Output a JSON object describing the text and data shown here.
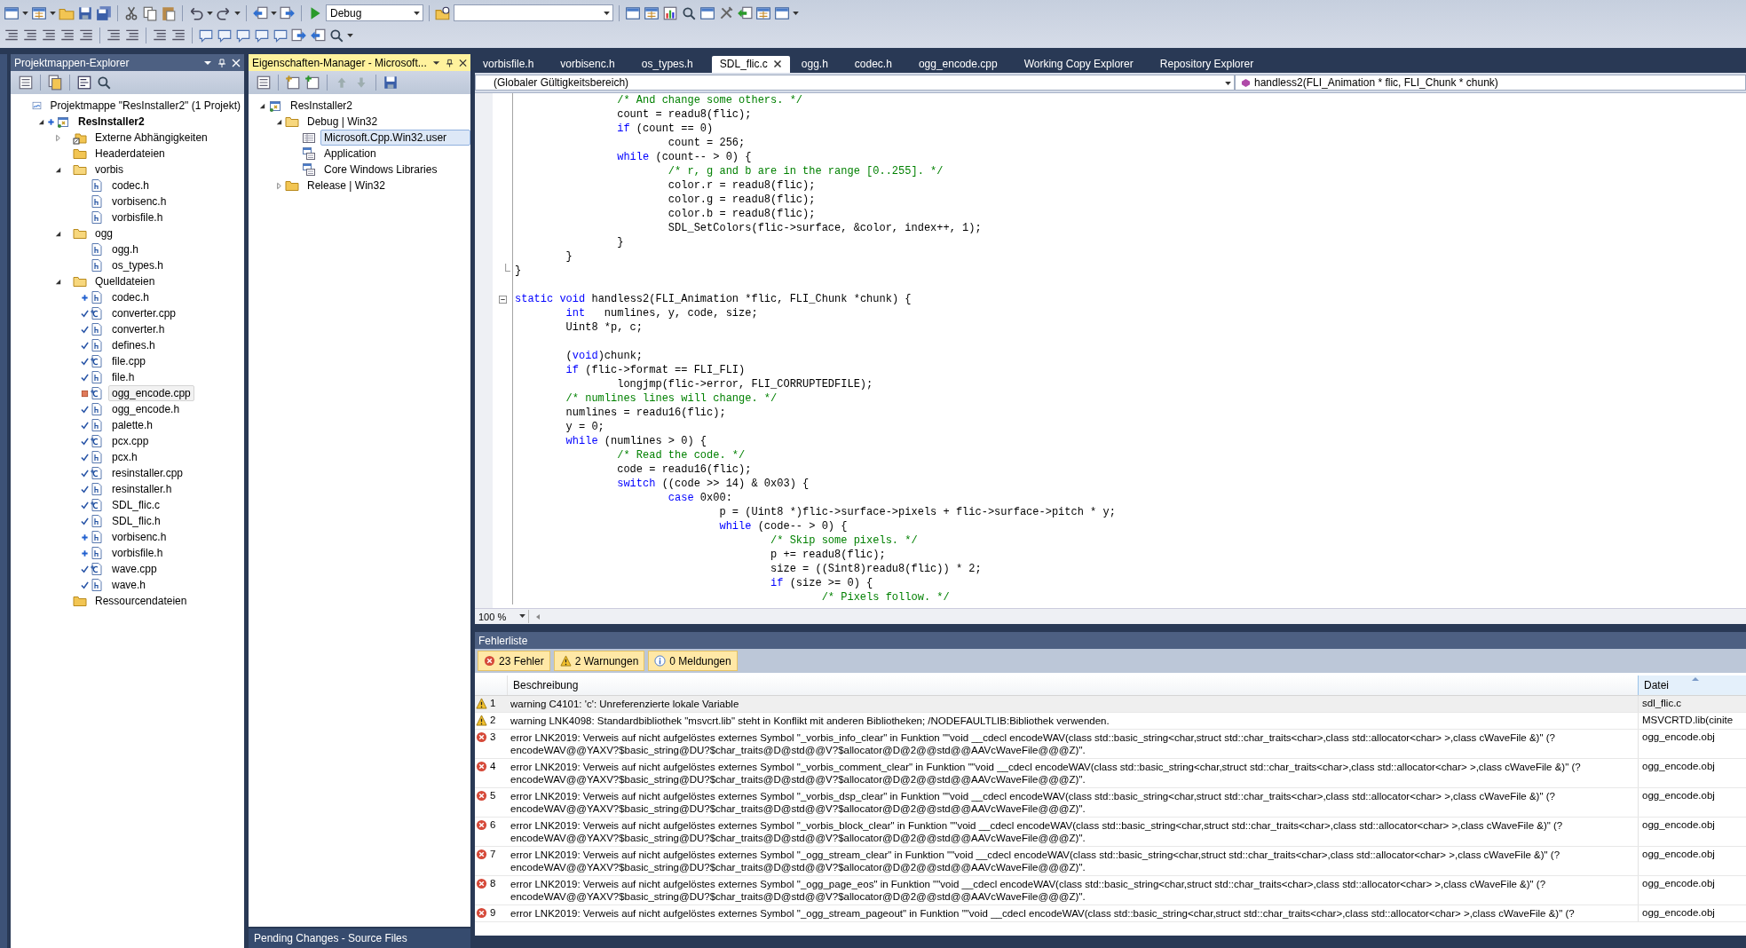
{
  "toolbar": {
    "configuration": "Debug"
  },
  "solution_explorer": {
    "title": "Projektmappen-Explorer",
    "active": false,
    "tree": [
      {
        "label": "Projektmappe \"ResInstaller2\" (1 Projekt)",
        "kind": "solution",
        "selected": false,
        "children": [
          {
            "label": "ResInstaller2",
            "kind": "project",
            "scc": {
              "kind": "added"
            },
            "startup": true,
            "expanded": true,
            "selected": false,
            "children": [
              {
                "label": "Externe Abhängigkeiten",
                "kind": "references",
                "expanded": false,
                "selected": false
              },
              {
                "label": "Headerdateien",
                "kind": "folder",
                "selected": false
              },
              {
                "label": "vorbis",
                "kind": "folder",
                "expanded": true,
                "selected": false,
                "children": [
                  {
                    "label": "codec.h",
                    "kind": "header",
                    "selected": false
                  },
                  {
                    "label": "vorbisenc.h",
                    "kind": "header",
                    "selected": false
                  },
                  {
                    "label": "vorbisfile.h",
                    "kind": "header",
                    "selected": false
                  }
                ]
              },
              {
                "label": "ogg",
                "kind": "folder",
                "expanded": true,
                "selected": false,
                "children": [
                  {
                    "label": "ogg.h",
                    "kind": "header",
                    "selected": false
                  },
                  {
                    "label": "os_types.h",
                    "kind": "header",
                    "selected": false
                  }
                ]
              },
              {
                "label": "Quelldateien",
                "kind": "folder",
                "expanded": true,
                "selected": false,
                "children": [
                  {
                    "label": "codec.h",
                    "kind": "header",
                    "scc": {
                      "kind": "added"
                    },
                    "selected": false
                  },
                  {
                    "label": "converter.cpp",
                    "kind": "source",
                    "scc": {
                      "kind": "checked-in"
                    },
                    "selected": false
                  },
                  {
                    "label": "converter.h",
                    "kind": "header",
                    "scc": {
                      "kind": "checked-in"
                    },
                    "selected": false
                  },
                  {
                    "label": "defines.h",
                    "kind": "header",
                    "scc": {
                      "kind": "checked-in"
                    },
                    "selected": false
                  },
                  {
                    "label": "file.cpp",
                    "kind": "source",
                    "scc": {
                      "kind": "checked-in"
                    },
                    "selected": false
                  },
                  {
                    "label": "file.h",
                    "kind": "header",
                    "scc": {
                      "kind": "checked-in"
                    },
                    "selected": false
                  },
                  {
                    "label": "ogg_encode.cpp",
                    "kind": "source",
                    "scc": {
                      "kind": "modified"
                    },
                    "selected": true
                  },
                  {
                    "label": "ogg_encode.h",
                    "kind": "header",
                    "scc": {
                      "kind": "checked-in"
                    },
                    "selected": false
                  },
                  {
                    "label": "palette.h",
                    "kind": "header",
                    "scc": {
                      "kind": "checked-in"
                    },
                    "selected": false
                  },
                  {
                    "label": "pcx.cpp",
                    "kind": "source",
                    "scc": {
                      "kind": "checked-in"
                    },
                    "selected": false
                  },
                  {
                    "label": "pcx.h",
                    "kind": "header",
                    "scc": {
                      "kind": "checked-in"
                    },
                    "selected": false
                  },
                  {
                    "label": "resinstaller.cpp",
                    "kind": "source",
                    "scc": {
                      "kind": "checked-in"
                    },
                    "selected": false
                  },
                  {
                    "label": "resinstaller.h",
                    "kind": "header",
                    "scc": {
                      "kind": "checked-in"
                    },
                    "selected": false
                  },
                  {
                    "label": "SDL_flic.c",
                    "kind": "source",
                    "scc": {
                      "kind": "checked-in"
                    },
                    "selected": false
                  },
                  {
                    "label": "SDL_flic.h",
                    "kind": "header",
                    "scc": {
                      "kind": "checked-in"
                    },
                    "selected": false
                  },
                  {
                    "label": "vorbisenc.h",
                    "kind": "header",
                    "scc": {
                      "kind": "added"
                    },
                    "selected": false
                  },
                  {
                    "label": "vorbisfile.h",
                    "kind": "header",
                    "scc": {
                      "kind": "added"
                    },
                    "selected": false
                  },
                  {
                    "label": "wave.cpp",
                    "kind": "source",
                    "scc": {
                      "kind": "checked-in"
                    },
                    "selected": false
                  },
                  {
                    "label": "wave.h",
                    "kind": "header",
                    "scc": {
                      "kind": "checked-in"
                    },
                    "selected": false
                  }
                ]
              },
              {
                "label": "Ressourcendateien",
                "kind": "folder",
                "selected": false
              }
            ]
          }
        ]
      }
    ]
  },
  "property_manager": {
    "title": "Eigenschaften-Manager - Microsoft...",
    "active": true,
    "tree": [
      {
        "label": "ResInstaller2",
        "kind": "project",
        "expanded": true,
        "selected": false,
        "children": [
          {
            "label": "Debug | Win32",
            "kind": "folder",
            "expanded": true,
            "selected": false,
            "children": [
              {
                "label": "Microsoft.Cpp.Win32.user",
                "kind": "sheet",
                "selected": true
              },
              {
                "label": "Application",
                "kind": "property-sheet",
                "selected": false
              },
              {
                "label": "Core Windows Libraries",
                "kind": "property-sheet",
                "selected": false
              }
            ]
          },
          {
            "label": "Release | Win32",
            "kind": "folder",
            "expanded": false,
            "selected": false
          }
        ]
      }
    ]
  },
  "pending_changes_tab": "Pending Changes - Source Files",
  "editor": {
    "tabs": [
      {
        "label": "vorbisfile.h",
        "selected": false
      },
      {
        "label": "vorbisenc.h",
        "selected": false
      },
      {
        "label": "os_types.h",
        "selected": false
      },
      {
        "label": "SDL_flic.c",
        "selected": true
      },
      {
        "label": "ogg.h",
        "selected": false
      },
      {
        "label": "codec.h",
        "selected": false
      },
      {
        "label": "ogg_encode.cpp",
        "selected": false
      },
      {
        "label": "Working Copy Explorer",
        "selected": false
      },
      {
        "label": "Repository Explorer",
        "selected": false
      }
    ],
    "scope": "(Globaler Gültigkeitsbereich)",
    "member": "handless2(FLI_Animation * flic, FLI_Chunk * chunk)",
    "zoom": "100 %",
    "lines": [
      {
        "kind": "code",
        "tokens": [
          {
            "kind": "comment",
            "text": "\t\t/* And change some others. */"
          }
        ]
      },
      {
        "kind": "code",
        "tokens": [
          {
            "kind": "plain",
            "text": "\t\tcount = readu8(flic);"
          }
        ]
      },
      {
        "kind": "code",
        "tokens": [
          {
            "kind": "keyword",
            "text": "\t\tif"
          },
          {
            "kind": "plain",
            "text": " (count == 0)"
          }
        ]
      },
      {
        "kind": "code",
        "tokens": [
          {
            "kind": "plain",
            "text": "\t\t\tcount = 256;"
          }
        ]
      },
      {
        "kind": "code",
        "tokens": [
          {
            "kind": "keyword",
            "text": "\t\twhile"
          },
          {
            "kind": "plain",
            "text": " (count-- > 0) {"
          }
        ]
      },
      {
        "kind": "code",
        "tokens": [
          {
            "kind": "comment",
            "text": "\t\t\t/* r, g and b are in the range [0..255]. */"
          }
        ]
      },
      {
        "kind": "code",
        "tokens": [
          {
            "kind": "plain",
            "text": "\t\t\tcolor.r = readu8(flic);"
          }
        ]
      },
      {
        "kind": "code",
        "tokens": [
          {
            "kind": "plain",
            "text": "\t\t\tcolor.g = readu8(flic);"
          }
        ]
      },
      {
        "kind": "code",
        "tokens": [
          {
            "kind": "plain",
            "text": "\t\t\tcolor.b = readu8(flic);"
          }
        ]
      },
      {
        "kind": "code",
        "tokens": [
          {
            "kind": "plain",
            "text": "\t\t\tSDL_SetColors(flic->surface, &color, index++, 1);"
          }
        ]
      },
      {
        "kind": "code",
        "tokens": [
          {
            "kind": "plain",
            "text": "\t\t}"
          }
        ]
      },
      {
        "kind": "code",
        "tokens": [
          {
            "kind": "plain",
            "text": "\t}"
          }
        ]
      },
      {
        "kind": "code",
        "fold": {
          "kind": "end"
        },
        "tokens": [
          {
            "kind": "plain",
            "text": "}"
          }
        ]
      },
      {
        "kind": "blank"
      },
      {
        "kind": "code",
        "fold": {
          "kind": "start"
        },
        "tokens": [
          {
            "kind": "keyword",
            "text": "static"
          },
          {
            "kind": "keyword",
            "text": " void"
          },
          {
            "kind": "plain",
            "text": " handless2(FLI_Animation *flic, FLI_Chunk *chunk) {"
          }
        ]
      },
      {
        "kind": "code",
        "tokens": [
          {
            "kind": "keyword",
            "text": "\tint"
          },
          {
            "kind": "plain",
            "text": "   numlines, y, code, size;"
          }
        ]
      },
      {
        "kind": "code",
        "tokens": [
          {
            "kind": "plain",
            "text": "\tUint8 *p, c;"
          }
        ]
      },
      {
        "kind": "blank"
      },
      {
        "kind": "code",
        "tokens": [
          {
            "kind": "plain",
            "text": "\t("
          },
          {
            "kind": "keyword",
            "text": "void"
          },
          {
            "kind": "plain",
            "text": ")chunk;"
          }
        ]
      },
      {
        "kind": "code",
        "tokens": [
          {
            "kind": "keyword",
            "text": "\tif"
          },
          {
            "kind": "plain",
            "text": " (flic->format == FLI_FLI)"
          }
        ]
      },
      {
        "kind": "code",
        "tokens": [
          {
            "kind": "plain",
            "text": "\t\tlongjmp(flic->error, FLI_CORRUPTEDFILE);"
          }
        ]
      },
      {
        "kind": "code",
        "tokens": [
          {
            "kind": "comment",
            "text": "\t/* numlines lines will change. */"
          }
        ]
      },
      {
        "kind": "code",
        "tokens": [
          {
            "kind": "plain",
            "text": "\tnumlines = readu16(flic);"
          }
        ]
      },
      {
        "kind": "code",
        "tokens": [
          {
            "kind": "plain",
            "text": "\ty = 0;"
          }
        ]
      },
      {
        "kind": "code",
        "tokens": [
          {
            "kind": "keyword",
            "text": "\twhile"
          },
          {
            "kind": "plain",
            "text": " (numlines > 0) {"
          }
        ]
      },
      {
        "kind": "code",
        "tokens": [
          {
            "kind": "comment",
            "text": "\t\t/* Read the code. */"
          }
        ]
      },
      {
        "kind": "code",
        "tokens": [
          {
            "kind": "plain",
            "text": "\t\tcode = readu16(flic);"
          }
        ]
      },
      {
        "kind": "code",
        "tokens": [
          {
            "kind": "keyword",
            "text": "\t\tswitch"
          },
          {
            "kind": "plain",
            "text": " ((code >> 14) & 0x03) {"
          }
        ]
      },
      {
        "kind": "code",
        "tokens": [
          {
            "kind": "keyword",
            "text": "\t\t\tcase"
          },
          {
            "kind": "plain",
            "text": " 0x00:"
          }
        ]
      },
      {
        "kind": "code",
        "tokens": [
          {
            "kind": "plain",
            "text": "\t\t\t\tp = (Uint8 *)flic->surface->pixels + flic->surface->pitch * y;"
          }
        ]
      },
      {
        "kind": "code",
        "tokens": [
          {
            "kind": "keyword",
            "text": "\t\t\t\twhile"
          },
          {
            "kind": "plain",
            "text": " (code-- > 0) {"
          }
        ]
      },
      {
        "kind": "code",
        "tokens": [
          {
            "kind": "comment",
            "text": "\t\t\t\t\t/* Skip some pixels. */"
          }
        ]
      },
      {
        "kind": "code",
        "tokens": [
          {
            "kind": "plain",
            "text": "\t\t\t\t\tp += readu8(flic);"
          }
        ]
      },
      {
        "kind": "code",
        "tokens": [
          {
            "kind": "plain",
            "text": "\t\t\t\t\tsize = ((Sint8)readu8(flic)) * 2;"
          }
        ]
      },
      {
        "kind": "code",
        "tokens": [
          {
            "kind": "keyword",
            "text": "\t\t\t\t\tif"
          },
          {
            "kind": "plain",
            "text": " (size >= 0) {"
          }
        ]
      },
      {
        "kind": "code",
        "tokens": [
          {
            "kind": "comment",
            "text": "\t\t\t\t\t\t/* Pixels follow. */"
          }
        ]
      }
    ]
  },
  "error_list": {
    "title": "Fehlerliste",
    "filters": [
      {
        "kind": "error",
        "label": "23 Fehler",
        "on": true
      },
      {
        "kind": "warning",
        "label": "2 Warnungen",
        "on": true
      },
      {
        "kind": "info",
        "label": "0 Meldungen",
        "on": true
      }
    ],
    "columns": [
      "Beschreibung",
      "Datei"
    ],
    "rows": [
      {
        "kind": "warning",
        "number": "1",
        "lines": [
          "warning C4101: 'c': Unreferenzierte lokale Variable"
        ],
        "file": "sdl_flic.c",
        "selected": true
      },
      {
        "kind": "warning",
        "number": "2",
        "lines": [
          "warning LNK4098: Standardbibliothek \"msvcrt.lib\" steht in Konflikt mit anderen Bibliotheken; /NODEFAULTLIB:Bibliothek verwenden."
        ],
        "file": "MSVCRTD.lib(cinite",
        "selected": false
      },
      {
        "kind": "error",
        "number": "3",
        "lines": [
          "error LNK2019: Verweis auf nicht aufgelöstes externes Symbol \"_vorbis_info_clear\" in Funktion \"\"void __cdecl encodeWAV(class std::basic_string<char,struct std::char_traits<char>,class std::allocator<char> >,class cWaveFile &)\" (?",
          "encodeWAV@@YAXV?$basic_string@DU?$char_traits@D@std@@V?$allocator@D@2@@std@@AAVcWaveFile@@@Z)\"."
        ],
        "file": "ogg_encode.obj",
        "selected": false
      },
      {
        "kind": "error",
        "number": "4",
        "lines": [
          "error LNK2019: Verweis auf nicht aufgelöstes externes Symbol \"_vorbis_comment_clear\" in Funktion \"\"void __cdecl encodeWAV(class std::basic_string<char,struct std::char_traits<char>,class std::allocator<char> >,class cWaveFile &)\" (?",
          "encodeWAV@@YAXV?$basic_string@DU?$char_traits@D@std@@V?$allocator@D@2@@std@@AAVcWaveFile@@@Z)\"."
        ],
        "file": "ogg_encode.obj",
        "selected": false
      },
      {
        "kind": "error",
        "number": "5",
        "lines": [
          "error LNK2019: Verweis auf nicht aufgelöstes externes Symbol \"_vorbis_dsp_clear\" in Funktion \"\"void __cdecl encodeWAV(class std::basic_string<char,struct std::char_traits<char>,class std::allocator<char> >,class cWaveFile &)\" (?",
          "encodeWAV@@YAXV?$basic_string@DU?$char_traits@D@std@@V?$allocator@D@2@@std@@AAVcWaveFile@@@Z)\"."
        ],
        "file": "ogg_encode.obj",
        "selected": false
      },
      {
        "kind": "error",
        "number": "6",
        "lines": [
          "error LNK2019: Verweis auf nicht aufgelöstes externes Symbol \"_vorbis_block_clear\" in Funktion \"\"void __cdecl encodeWAV(class std::basic_string<char,struct std::char_traits<char>,class std::allocator<char> >,class cWaveFile &)\" (?",
          "encodeWAV@@YAXV?$basic_string@DU?$char_traits@D@std@@V?$allocator@D@2@@std@@AAVcWaveFile@@@Z)\"."
        ],
        "file": "ogg_encode.obj",
        "selected": false
      },
      {
        "kind": "error",
        "number": "7",
        "lines": [
          "error LNK2019: Verweis auf nicht aufgelöstes externes Symbol \"_ogg_stream_clear\" in Funktion \"\"void __cdecl encodeWAV(class std::basic_string<char,struct std::char_traits<char>,class std::allocator<char> >,class cWaveFile &)\" (?",
          "encodeWAV@@YAXV?$basic_string@DU?$char_traits@D@std@@V?$allocator@D@2@@std@@AAVcWaveFile@@@Z)\"."
        ],
        "file": "ogg_encode.obj",
        "selected": false
      },
      {
        "kind": "error",
        "number": "8",
        "lines": [
          "error LNK2019: Verweis auf nicht aufgelöstes externes Symbol \"_ogg_page_eos\" in Funktion \"\"void __cdecl encodeWAV(class std::basic_string<char,struct std::char_traits<char>,class std::allocator<char> >,class cWaveFile &)\" (?",
          "encodeWAV@@YAXV?$basic_string@DU?$char_traits@D@std@@V?$allocator@D@2@@std@@AAVcWaveFile@@@Z)\"."
        ],
        "file": "ogg_encode.obj",
        "selected": false
      },
      {
        "kind": "error",
        "number": "9",
        "lines": [
          "error LNK2019: Verweis auf nicht aufgelöstes externes Symbol \"_ogg_stream_pageout\" in Funktion \"\"void __cdecl encodeWAV(class std::basic_string<char,struct std::char_traits<char>,class std::allocator<char> >,class cWaveFile &)\" (?"
        ],
        "file": "ogg_encode.obj",
        "selected": false
      }
    ]
  }
}
